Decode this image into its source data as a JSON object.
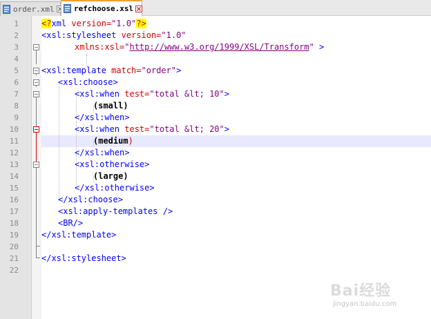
{
  "tabs": [
    {
      "label": "order.xml",
      "active": false,
      "icon": "file-icon"
    },
    {
      "label": "refchoose.xsl",
      "active": true,
      "icon": "file-icon"
    }
  ],
  "editor": {
    "current_line": 11,
    "lines": [
      {
        "n": "1"
      },
      {
        "n": "2"
      },
      {
        "n": "3"
      },
      {
        "n": "4"
      },
      {
        "n": "5"
      },
      {
        "n": "6"
      },
      {
        "n": "7"
      },
      {
        "n": "8"
      },
      {
        "n": "9"
      },
      {
        "n": "10"
      },
      {
        "n": "11"
      },
      {
        "n": "12"
      },
      {
        "n": "13"
      },
      {
        "n": "14"
      },
      {
        "n": "15"
      },
      {
        "n": "16"
      },
      {
        "n": "17"
      },
      {
        "n": "18"
      },
      {
        "n": "19"
      },
      {
        "n": "20"
      },
      {
        "n": "21"
      },
      {
        "n": "22"
      }
    ],
    "code": {
      "l1": [
        "<?",
        "xml",
        " version=",
        "\"1.0\"",
        "?>"
      ],
      "l2": [
        "<xsl:stylesheet ",
        "version=",
        "\"1.0\""
      ],
      "l3": [
        "xmlns:xsl=",
        "\"",
        "http://www.w3.org/1999/XSL/Transform",
        "\"",
        " >"
      ],
      "l5": [
        "<xsl:template ",
        "match=",
        "\"order\"",
        ">"
      ],
      "l6": [
        "<xsl:choose>"
      ],
      "l7": [
        "<xsl:when ",
        "test=",
        "\"total &lt; 10\"",
        ">"
      ],
      "l8": [
        "(small)"
      ],
      "l9": [
        "</xsl:when>"
      ],
      "l10": [
        "<xsl:when ",
        "test=",
        "\"total &lt; 20\"",
        ">"
      ],
      "l11": [
        "(medium",
        ")"
      ],
      "l12": [
        "</xsl:when>"
      ],
      "l13": [
        "<xsl:otherwise>"
      ],
      "l14": [
        "(large)"
      ],
      "l15": [
        "</xsl:otherwise>"
      ],
      "l16": [
        "</xsl:choose>"
      ],
      "l17": [
        "<xsl:apply-templates />"
      ],
      "l18": [
        "<BR/>"
      ],
      "l19": [
        "</xsl:template>"
      ],
      "l21": [
        "</xsl:stylesheet>"
      ]
    }
  },
  "watermark": {
    "brand": "Bai经验",
    "url": "jingyan.baidu.com"
  },
  "colors": {
    "tag": "#0000ff",
    "attribute": "#d00000",
    "value": "#7f007f",
    "highlight_line": "#e8e8ff",
    "pi_highlight": "#ffff00"
  }
}
